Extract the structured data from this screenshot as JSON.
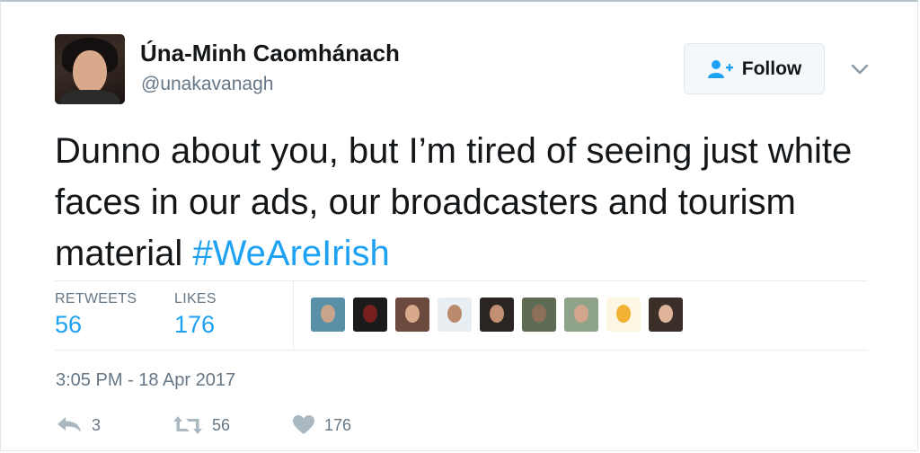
{
  "user": {
    "display_name": "Úna-Minh Caomhánach",
    "handle": "@unakavanagh"
  },
  "follow_button": {
    "label": "Follow",
    "icon": "add-user-icon"
  },
  "more_menu": {
    "icon": "chevron-down-icon"
  },
  "tweet": {
    "text": "Dunno about you, but I’m tired of seeing just white faces in our ads, our broadcasters and tourism material",
    "hashtag": "#WeAreIrish"
  },
  "stats": {
    "retweets_label": "RETWEETS",
    "retweets_value": "56",
    "likes_label": "LIKES",
    "likes_value": "176",
    "liker_avatars": [
      {
        "bg": "#5a8fa8",
        "face": "#c9a58b"
      },
      {
        "bg": "#1b1b1b",
        "face": "#7a1f1f"
      },
      {
        "bg": "#6c4a3e",
        "face": "#d8a98d"
      },
      {
        "bg": "#e9eef2",
        "face": "#b98a6b"
      },
      {
        "bg": "#2a2522",
        "face": "#c28f72"
      },
      {
        "bg": "#5e6b55",
        "face": "#8b6f5a"
      },
      {
        "bg": "#8fa38a",
        "face": "#d2a68c"
      },
      {
        "bg": "#fdf6e2",
        "face": "#f2b233"
      },
      {
        "bg": "#3c2f2a",
        "face": "#dfb49a"
      }
    ]
  },
  "timestamp": "3:05 PM - 18 Apr 2017",
  "actions": {
    "reply_count": "3",
    "retweet_count": "56",
    "like_count": "176"
  },
  "colors": {
    "accent": "#1da1f2",
    "muted": "#657786",
    "text": "#14171a",
    "action_icon": "#aab8c2"
  }
}
